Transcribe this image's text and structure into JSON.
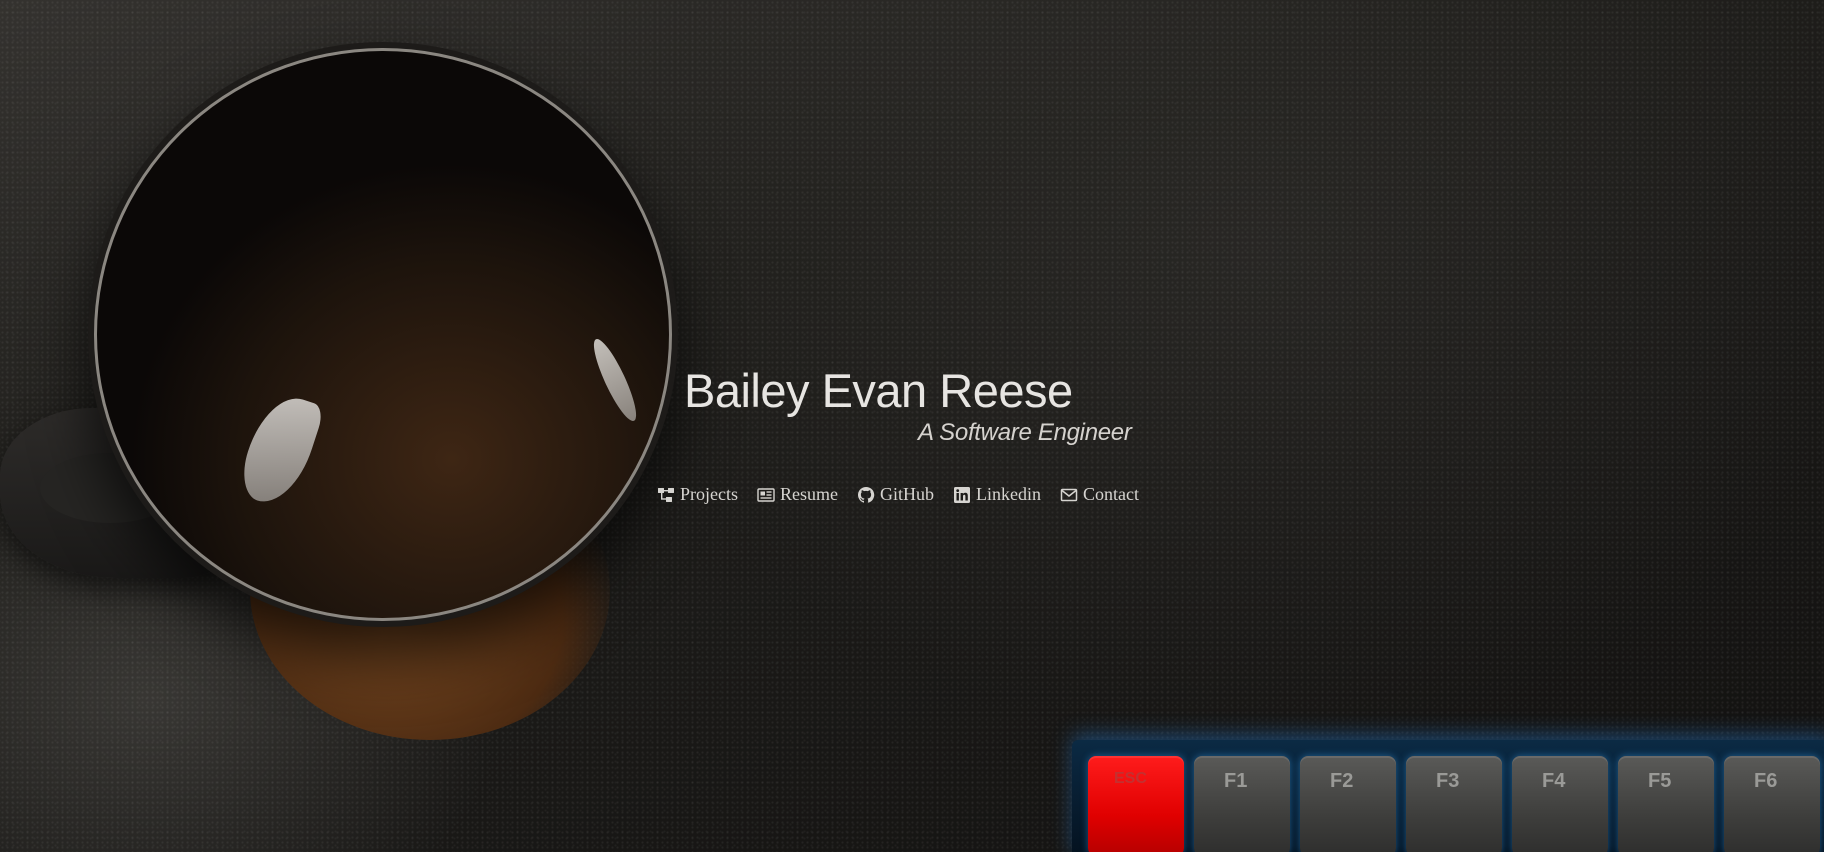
{
  "header": {
    "name": "Bailey Evan Reese",
    "tagline": "A Software Engineer"
  },
  "nav": {
    "items": [
      {
        "label": "Projects",
        "icon": "sitemap-icon"
      },
      {
        "label": "Resume",
        "icon": "newspaper-icon"
      },
      {
        "label": "GitHub",
        "icon": "github-icon"
      },
      {
        "label": "Linkedin",
        "icon": "linkedin-icon"
      },
      {
        "label": "Contact",
        "icon": "envelope-icon"
      }
    ]
  },
  "background": {
    "keys": [
      "ESC",
      "F1",
      "F2",
      "F3",
      "F4",
      "F5",
      "F6"
    ]
  },
  "colors": {
    "text": "#e7e5e2",
    "esc_key": "#e00000",
    "keyboard_glow": "#2896ff"
  }
}
